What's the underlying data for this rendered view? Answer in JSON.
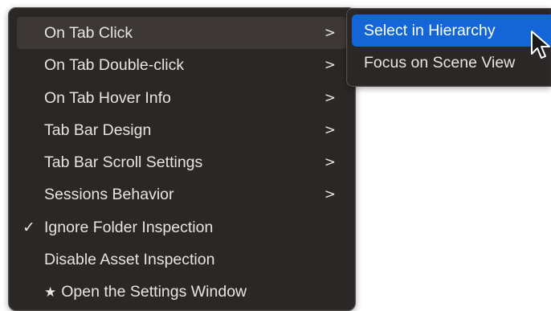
{
  "menu": {
    "items": [
      {
        "label": "On Tab Click",
        "submenu": true,
        "state": "hovered"
      },
      {
        "label": "On Tab Double-click",
        "submenu": true
      },
      {
        "label": "On Tab Hover Info",
        "submenu": true
      },
      {
        "label": "Tab Bar Design",
        "submenu": true
      },
      {
        "label": "Tab Bar Scroll Settings",
        "submenu": true
      },
      {
        "label": "Sessions Behavior",
        "submenu": true
      },
      {
        "label": "Ignore Folder Inspection",
        "checked": true
      },
      {
        "label": "Disable Asset Inspection"
      },
      {
        "label": "Open the Settings Window",
        "prefix_icon": "star-icon"
      }
    ],
    "chevron_glyph": ">",
    "check_glyph": "✓",
    "star_glyph": "★"
  },
  "submenu": {
    "items": [
      {
        "label": "Select in Hierarchy",
        "state": "selected"
      },
      {
        "label": "Focus on Scene View"
      }
    ]
  },
  "colors": {
    "menu_background": "#2b2726",
    "menu_text": "#e8e4e2",
    "hover_background": "#3d3836",
    "selection_accent": "#1466d6"
  }
}
